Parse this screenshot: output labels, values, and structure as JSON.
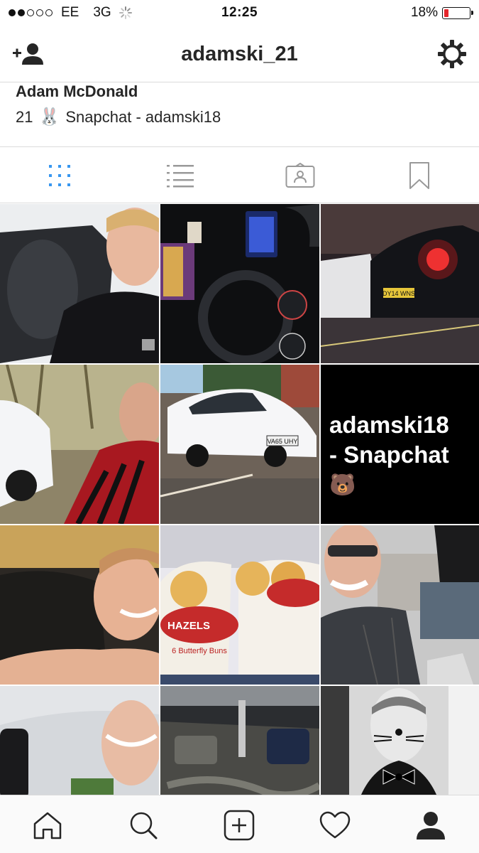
{
  "status_bar": {
    "carrier": "EE",
    "network": "3G",
    "time": "12:25",
    "battery_percent": "18%",
    "battery_level": 0.18,
    "signal_bars_filled": 2,
    "signal_bars_total": 5,
    "battery_color": "#e5252b"
  },
  "header": {
    "username": "adamski_21",
    "left_icon": "add-user-icon",
    "right_icon": "gear-icon"
  },
  "profile": {
    "name": "Adam McDonald",
    "bio_age": "21",
    "bio_emoji": "🐰",
    "bio_text": "Snapchat - adamski18"
  },
  "view_tabs": [
    {
      "name": "grid-view",
      "icon": "grid-icon",
      "active": true
    },
    {
      "name": "list-view",
      "icon": "list-icon",
      "active": false
    },
    {
      "name": "tagged",
      "icon": "tagged-photos-icon",
      "active": false
    },
    {
      "name": "saved",
      "icon": "bookmark-icon",
      "active": false
    }
  ],
  "grid_posts": [
    {
      "desc": "selfie-on-pillow"
    },
    {
      "desc": "car-dashboard"
    },
    {
      "desc": "car-rear-lights-night"
    },
    {
      "desc": "selfie-scarf-white-car"
    },
    {
      "desc": "white-car-parked"
    },
    {
      "desc": "snapchat-promo",
      "line1": "adamski18",
      "line2": "- Snapchat",
      "emoji": "🐻"
    },
    {
      "desc": "smiling-selfie"
    },
    {
      "desc": "butterfly-buns",
      "brand": "HAZELS",
      "product": "6 Butterfly Buns"
    },
    {
      "desc": "car-selfie-sunglasses"
    },
    {
      "desc": "car-interior-selfie"
    },
    {
      "desc": "engine-bay"
    },
    {
      "desc": "cat-face-paint-bow-tie"
    }
  ],
  "plates": {
    "rear": "DY14 WNS",
    "front": "VA65 UHY"
  },
  "tab_bar": [
    {
      "name": "home",
      "icon": "home-icon"
    },
    {
      "name": "search",
      "icon": "search-icon"
    },
    {
      "name": "new-post",
      "icon": "add-post-icon"
    },
    {
      "name": "activity",
      "icon": "heart-icon"
    },
    {
      "name": "profile",
      "icon": "profile-icon",
      "active": true
    }
  ],
  "colors": {
    "active_tab": "#3897f0",
    "inactive": "#999999",
    "text": "#262626",
    "divider": "#dbdbdb"
  }
}
